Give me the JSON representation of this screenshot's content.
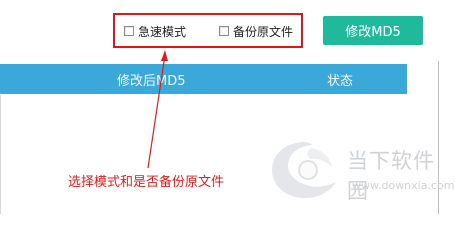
{
  "options": {
    "fast_mode_label": "急速模式",
    "backup_label": "备份原文件"
  },
  "toolbar": {
    "modify_button_label": "修改MD5"
  },
  "table": {
    "columns": [
      "修改后MD5",
      "状态"
    ]
  },
  "annotation": {
    "text": "选择模式和是否备份原文件"
  },
  "watermark": {
    "name": "当下软件园",
    "url": "www.downxia.com"
  },
  "colors": {
    "accent_button": "#1fba9b",
    "table_header": "#3aa9d9",
    "annotation_red": "#e31a1a"
  }
}
